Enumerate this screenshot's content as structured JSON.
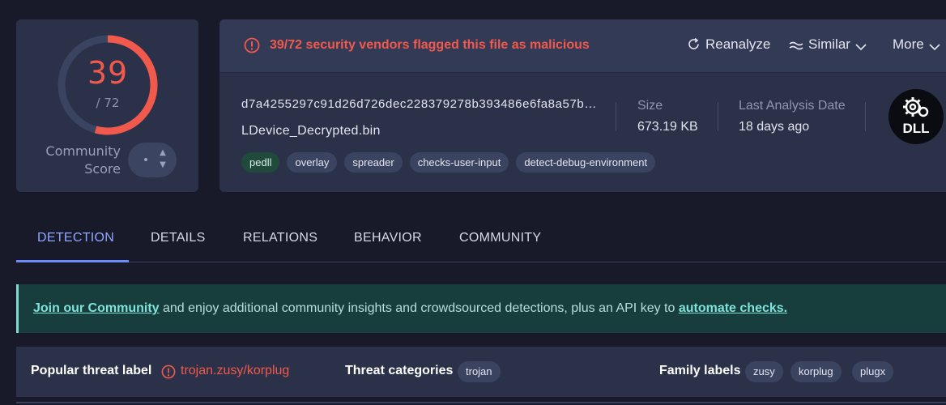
{
  "score": {
    "detections": "39",
    "total": "/ 72",
    "detected_fraction": 0.5417,
    "community_label_line1": "Community",
    "community_label_line2": "Score"
  },
  "header": {
    "flag_text": "39/72 security vendors flagged this file as malicious",
    "reanalyze_label": "Reanalyze",
    "similar_label": "Similar",
    "more_label": "More"
  },
  "file": {
    "hash": "d7a4255297c91d26d726dec228379278b393486e6fa8a57b…",
    "name": "LDevice_Decrypted.bin",
    "tags": [
      "pedll",
      "overlay",
      "spreader",
      "checks-user-input",
      "detect-debug-environment"
    ],
    "size_label": "Size",
    "size_value": "673.19 KB",
    "last_analysis_label": "Last Analysis Date",
    "last_analysis_value": "18 days ago",
    "type_icon_text": "DLL"
  },
  "tabs": [
    "DETECTION",
    "DETAILS",
    "RELATIONS",
    "BEHAVIOR",
    "COMMUNITY"
  ],
  "banner": {
    "link1": "Join our Community",
    "middle": " and enjoy additional community insights and crowdsourced detections, plus an API key to ",
    "link2": "automate checks."
  },
  "threat": {
    "popular_label": "Popular threat label",
    "popular_value": "trojan.zusy/korplug",
    "categories_label": "Threat categories",
    "categories": [
      "trojan"
    ],
    "family_label": "Family labels",
    "families": [
      "zusy",
      "korplug",
      "plugx"
    ]
  },
  "colors": {
    "background": "#181a2a",
    "card": "#2a3148",
    "danger": "#f2594d",
    "accent": "#6c8df5",
    "banner_bg": "#173e3d",
    "banner_link": "#7fe3da"
  }
}
